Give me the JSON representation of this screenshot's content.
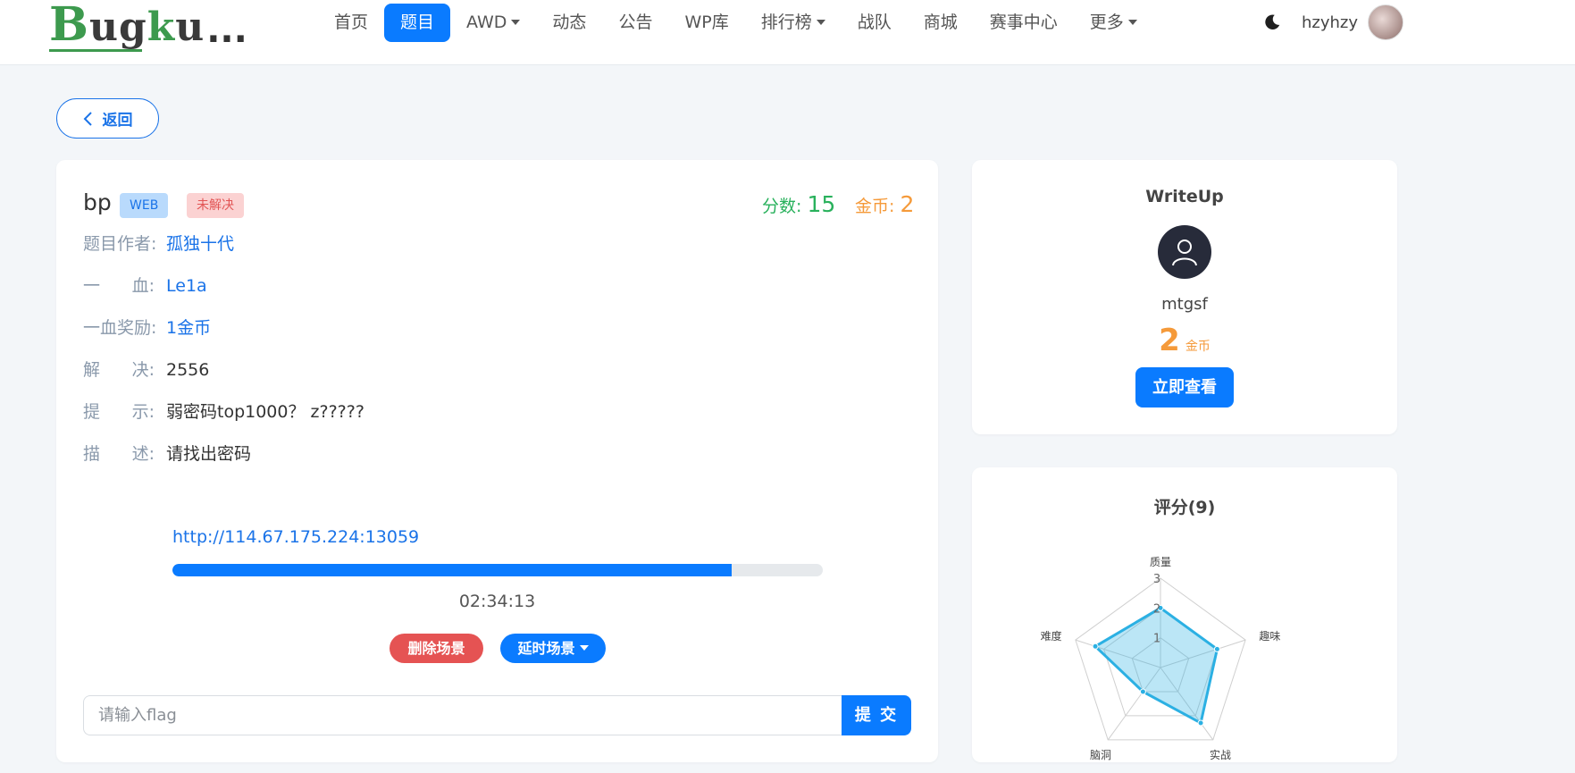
{
  "header": {
    "logo_text": "Bugku...",
    "nav": [
      {
        "label": "首页",
        "active": false,
        "dropdown": false
      },
      {
        "label": "题目",
        "active": true,
        "dropdown": false
      },
      {
        "label": "AWD",
        "active": false,
        "dropdown": true
      },
      {
        "label": "动态",
        "active": false,
        "dropdown": false
      },
      {
        "label": "公告",
        "active": false,
        "dropdown": false
      },
      {
        "label": "WP库",
        "active": false,
        "dropdown": false
      },
      {
        "label": "排行榜",
        "active": false,
        "dropdown": true
      },
      {
        "label": "战队",
        "active": false,
        "dropdown": false
      },
      {
        "label": "商城",
        "active": false,
        "dropdown": false
      },
      {
        "label": "赛事中心",
        "active": false,
        "dropdown": false
      },
      {
        "label": "更多",
        "active": false,
        "dropdown": true
      }
    ],
    "username": "hzyhzy",
    "theme_icon": "moon-icon"
  },
  "back_button": {
    "label": "返回",
    "icon": "chevron-left-icon"
  },
  "challenge": {
    "title": "bp",
    "category_tag": "WEB",
    "status_tag": "未解决",
    "score_label": "分数:",
    "score_value": "15",
    "coin_label": "金币:",
    "coin_value": "2",
    "author_label": "题目作者:",
    "author": "孤独十代",
    "first_blood_label_a": "一",
    "first_blood_label_b": "血:",
    "first_blood": "Le1a",
    "first_blood_reward_label": "一血奖励:",
    "first_blood_reward": "1金币",
    "solves_label_a": "解",
    "solves_label_b": "决:",
    "solves": "2556",
    "hint_label_a": "提",
    "hint_label_b": "示:",
    "hint": "弱密码top1000？ z?????",
    "desc_label_a": "描",
    "desc_label_b": "述:",
    "description": "请找出密码",
    "instance_url": "http://114.67.175.224:13059",
    "remaining_fraction": 0.86,
    "timer": "02:34:13",
    "delete_button": "删除场景",
    "delay_button": "延时场景",
    "flag_placeholder": "请输入flag",
    "submit_button": "提 交"
  },
  "writeup": {
    "title": "WriteUp",
    "author": "mtgsf",
    "price": "2",
    "price_unit": "金币",
    "view_button": "立即查看",
    "avatar_icon": "user-icon"
  },
  "rating": {
    "title": "评分(9)"
  },
  "chart_data": {
    "type": "radar",
    "axes": [
      "质量",
      "趣味",
      "实战",
      "脑洞",
      "难度"
    ],
    "values": [
      2.0,
      2.0,
      2.3,
      1.0,
      2.3
    ],
    "max": 3,
    "ticks": [
      "1",
      "2",
      "3"
    ],
    "color": "#2bb0e3"
  }
}
